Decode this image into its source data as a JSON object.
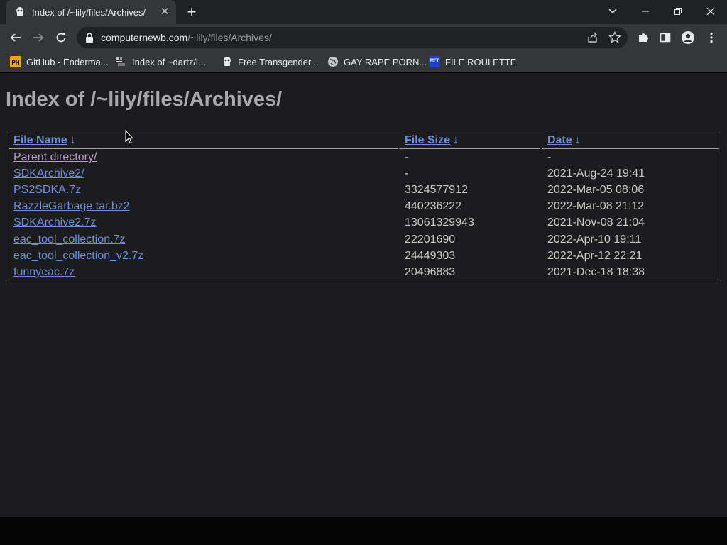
{
  "tab": {
    "title": "Index of /~lily/files/Archives/",
    "close": "✕"
  },
  "newtab": "+",
  "omnibox": {
    "host": "computernewb.com",
    "path": "/~lily/files/Archives/"
  },
  "bookmarks": [
    {
      "label": "GitHub - Enderma...",
      "icon": "ph-icon",
      "icon_text": "PH"
    },
    {
      "label": "Index of ~dartz/i...",
      "icon": "folder-icon",
      "icon_text": ""
    },
    {
      "label": "Free Transgender...",
      "icon": "site-icon",
      "icon_text": ""
    },
    {
      "label": "GAY RAPE PORN...",
      "icon": "globe-icon",
      "icon_text": ""
    },
    {
      "label": "FILE ROULETTE",
      "icon": "mft-icon",
      "icon_text": "MFT"
    }
  ],
  "page": {
    "heading": "Index of /~lily/files/Archives/",
    "columns": [
      {
        "label": "File Name",
        "arrow": "↓"
      },
      {
        "label": "File Size",
        "arrow": "↓"
      },
      {
        "label": "Date",
        "arrow": "↓"
      }
    ],
    "rows": [
      {
        "name": "Parent directory/",
        "size": "-",
        "date": "-"
      },
      {
        "name": "SDKArchive2/",
        "size": "-",
        "date": "2021-Aug-24 19:41"
      },
      {
        "name": "PS2SDKA.7z",
        "size": "3324577912",
        "date": "2022-Mar-05 08:06"
      },
      {
        "name": "RazzleGarbage.tar.bz2",
        "size": "440236222",
        "date": "2022-Mar-08 21:12"
      },
      {
        "name": "SDKArchive2.7z",
        "size": "13061329943",
        "date": "2021-Nov-08 21:04"
      },
      {
        "name": "eac_tool_collection.7z",
        "size": "22201690",
        "date": "2022-Apr-10 19:11"
      },
      {
        "name": "eac_tool_collection_v2.7z",
        "size": "24449303",
        "date": "2022-Apr-12 22:21"
      },
      {
        "name": "funnyeac.7z",
        "size": "20496883",
        "date": "2021-Dec-18 18:38"
      }
    ]
  },
  "colors": {
    "link": "#6e8fd6",
    "visited": "#b79ac9",
    "page_bg": "#1c1c1e",
    "chrome_bg": "#35363a"
  }
}
